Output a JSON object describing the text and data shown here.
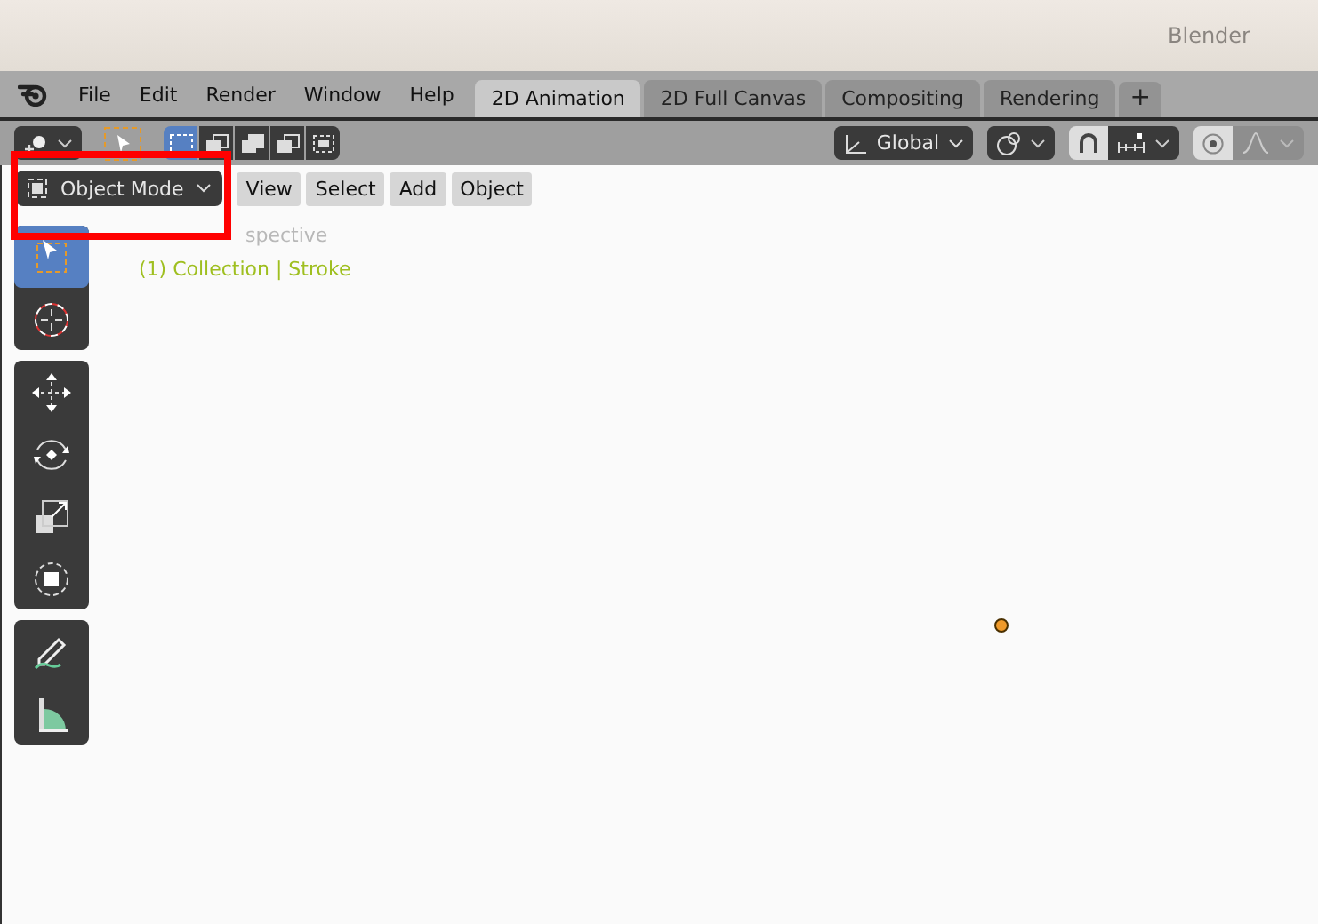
{
  "window": {
    "title": "Blender"
  },
  "menu": [
    "File",
    "Edit",
    "Render",
    "Window",
    "Help"
  ],
  "workspaces": [
    {
      "label": "2D Animation",
      "selected": true
    },
    {
      "label": "2D Full Canvas",
      "selected": false
    },
    {
      "label": "Compositing",
      "selected": false
    },
    {
      "label": "Rendering",
      "selected": false
    }
  ],
  "add_workspace": "+",
  "select_modes": [
    {
      "selected": true
    },
    {
      "selected": false
    },
    {
      "selected": false
    },
    {
      "selected": false
    },
    {
      "selected": false
    }
  ],
  "orientation": {
    "value": "Global"
  },
  "snap": {
    "on": true
  },
  "proportional_edit": {
    "on": true
  },
  "viewport_header": {
    "mode": "Object Mode",
    "menus": [
      "View",
      "Select",
      "Add",
      "Object"
    ]
  },
  "overlay": {
    "view_name": "spective",
    "collection": "(1) Collection | Stroke"
  },
  "tool_groups": [
    {
      "tools": [
        {
          "kind": "select",
          "selected": true
        },
        {
          "kind": "cursor",
          "selected": false
        }
      ]
    },
    {
      "tools": [
        {
          "kind": "move",
          "selected": false
        },
        {
          "kind": "rotate",
          "selected": false
        },
        {
          "kind": "scale",
          "selected": false
        },
        {
          "kind": "transform",
          "selected": false
        }
      ]
    },
    {
      "tools": [
        {
          "kind": "draw",
          "selected": false
        },
        {
          "kind": "measure",
          "selected": false
        }
      ]
    }
  ]
}
